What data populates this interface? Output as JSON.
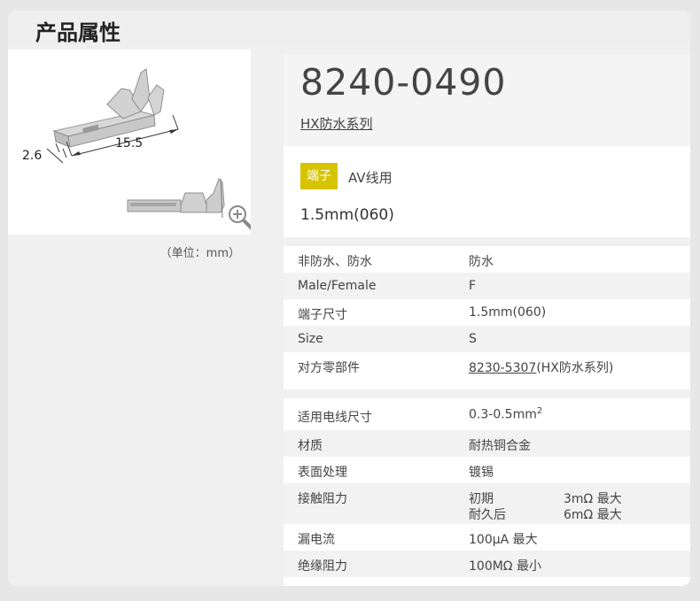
{
  "header": {
    "title": "产品属性"
  },
  "figure": {
    "dimension_small": "2.6",
    "dimension_large": "15.5",
    "unit_note": "（单位：mm）"
  },
  "product": {
    "part_number": "8240-0490",
    "series_link": "HX防水系列",
    "badge": "端子",
    "badge_side_text": "AV线用",
    "size_text": "1.5mm(060)"
  },
  "specs1": [
    {
      "key": "非防水、防水",
      "value": "防水"
    },
    {
      "key": "Male/Female",
      "value": "F"
    },
    {
      "key": "端子尺寸",
      "value": "1.5mm(060)"
    },
    {
      "key": "Size",
      "value": "S"
    },
    {
      "key": "对方零部件",
      "value_link": "8230-5307",
      "value_suffix": "(HX防水系列)"
    }
  ],
  "specs2": [
    {
      "key": "适用电线尺寸",
      "value": "0.3-0.5mm",
      "value_sup": "2"
    },
    {
      "key": "材质",
      "value": "耐热铜合金"
    },
    {
      "key": "表面处理",
      "value": "镀锡"
    },
    {
      "key": "接触阻力",
      "line1_label": "初期",
      "line1_value": "3mΩ 最大",
      "line2_label": "耐久后",
      "line2_value": "6mΩ 最大"
    },
    {
      "key": "漏电流",
      "value": "100μA 最大"
    },
    {
      "key": "绝缘阻力",
      "value": "100MΩ 最小"
    }
  ]
}
